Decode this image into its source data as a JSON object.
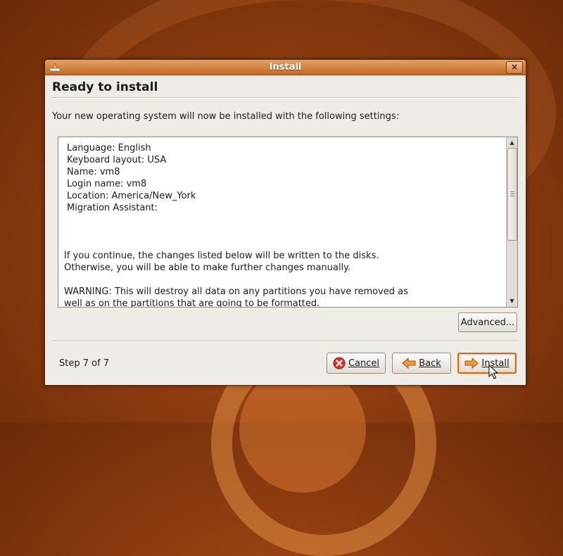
{
  "window": {
    "title": "Install",
    "close_label": "×"
  },
  "page": {
    "heading": "Ready to install",
    "intro": "Your new operating system will now be installed with the following settings:"
  },
  "summary_lines": [
    "Language: English",
    "Keyboard layout: USA",
    "Name: vm8",
    "Login name: vm8",
    "Location: America/New_York",
    "Migration Assistant:"
  ],
  "message_lines": [
    "If you continue, the changes listed below will be written to the disks.",
    "Otherwise, you will be able to make further changes manually."
  ],
  "warning_lines": [
    "WARNING: This will destroy all data on any partitions you have removed as",
    "well as on the partitions that are going to be formatted."
  ],
  "buttons": {
    "advanced": "Advanced...",
    "cancel": "Cancel",
    "back": "Back",
    "install": "Install"
  },
  "footer": {
    "step": "Step 7 of 7"
  },
  "colors": {
    "accent": "#d56b1b",
    "titlebar": "#c36a24",
    "desktop": "#8f3c10"
  },
  "icons": {
    "app": "installer-icon",
    "cancel": "cancel-icon",
    "back": "back-arrow-icon",
    "install": "forward-arrow-icon"
  }
}
